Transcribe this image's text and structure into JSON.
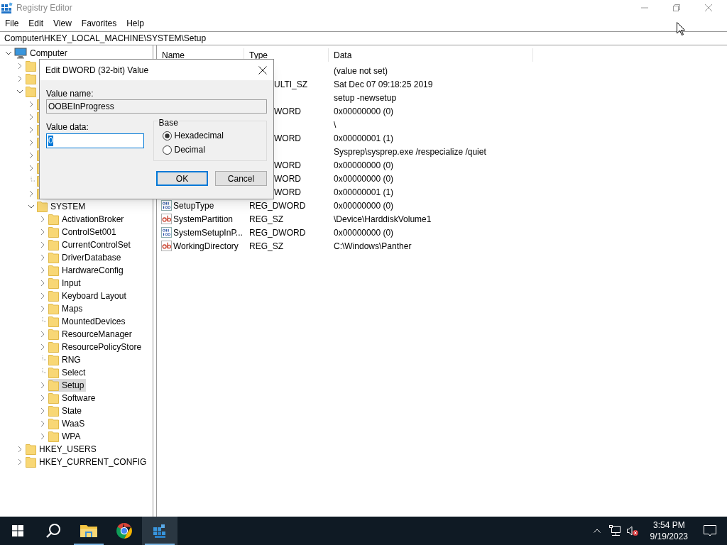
{
  "window": {
    "title": "Registry Editor"
  },
  "menu": [
    "File",
    "Edit",
    "View",
    "Favorites",
    "Help"
  ],
  "address": "Computer\\HKEY_LOCAL_MACHINE\\SYSTEM\\Setup",
  "tree": [
    {
      "label": "Computer",
      "kind": "computer",
      "expanded": true,
      "selected": false,
      "children": [
        {
          "kind": "folder",
          "expanded": false,
          "selected": false
        },
        {
          "kind": "folder",
          "expanded": false,
          "selected": false
        },
        {
          "kind": "folder",
          "expanded": true,
          "selected": false,
          "children": [
            {
              "kind": "folder",
              "expanded": false,
              "selected": false
            },
            {
              "kind": "folder",
              "expanded": false,
              "selected": false
            },
            {
              "kind": "folder",
              "expanded": false,
              "selected": false
            },
            {
              "kind": "folder",
              "expanded": false,
              "selected": false
            },
            {
              "kind": "folder",
              "expanded": false,
              "selected": false
            },
            {
              "kind": "folder",
              "expanded": false,
              "selected": false
            },
            {
              "kind": "leaf",
              "selected": false
            },
            {
              "kind": "folder",
              "expanded": false,
              "selected": false
            },
            {
              "label": "SYSTEM",
              "kind": "folder",
              "expanded": true,
              "selected": false,
              "children": [
                {
                  "label": "ActivationBroker",
                  "kind": "folder",
                  "expanded": false,
                  "selected": false
                },
                {
                  "label": "ControlSet001",
                  "kind": "folder",
                  "expanded": false,
                  "selected": false
                },
                {
                  "label": "CurrentControlSet",
                  "kind": "folder",
                  "expanded": false,
                  "selected": false
                },
                {
                  "label": "DriverDatabase",
                  "kind": "folder",
                  "expanded": false,
                  "selected": false
                },
                {
                  "label": "HardwareConfig",
                  "kind": "folder",
                  "expanded": false,
                  "selected": false
                },
                {
                  "label": "Input",
                  "kind": "folder",
                  "expanded": false,
                  "selected": false
                },
                {
                  "label": "Keyboard Layout",
                  "kind": "folder",
                  "expanded": false,
                  "selected": false
                },
                {
                  "label": "Maps",
                  "kind": "folder",
                  "expanded": false,
                  "selected": false
                },
                {
                  "label": "MountedDevices",
                  "kind": "leaf",
                  "selected": false
                },
                {
                  "label": "ResourceManager",
                  "kind": "folder",
                  "expanded": false,
                  "selected": false
                },
                {
                  "label": "ResourcePolicyStore",
                  "kind": "folder",
                  "expanded": false,
                  "selected": false
                },
                {
                  "label": "RNG",
                  "kind": "leaf",
                  "selected": false
                },
                {
                  "label": "Select",
                  "kind": "leaf",
                  "selected": false
                },
                {
                  "label": "Setup",
                  "kind": "folder",
                  "expanded": false,
                  "selected": true
                },
                {
                  "label": "Software",
                  "kind": "folder",
                  "expanded": false,
                  "selected": false
                },
                {
                  "label": "State",
                  "kind": "folder",
                  "expanded": false,
                  "selected": false
                },
                {
                  "label": "WaaS",
                  "kind": "folder",
                  "expanded": false,
                  "selected": false
                },
                {
                  "label": "WPA",
                  "kind": "folder",
                  "expanded": false,
                  "selected": false
                }
              ]
            }
          ]
        },
        {
          "label": "HKEY_USERS",
          "kind": "folder",
          "expanded": false,
          "selected": false
        },
        {
          "label": "HKEY_CURRENT_CONFIG",
          "kind": "folder",
          "expanded": false,
          "selected": false
        }
      ]
    }
  ],
  "table": {
    "columns": [
      "Name",
      "Type",
      "Data"
    ],
    "rows": [
      {
        "data": "(value not set)"
      },
      {
        "covered": true,
        "type": "ULTI_SZ",
        "data": "Sat Dec 07 09:18:25 2019"
      },
      {
        "data": "setup -newsetup"
      },
      {
        "covered": true,
        "type": "WORD",
        "data": "0x00000000 (0)"
      },
      {
        "data": "\\"
      },
      {
        "covered": true,
        "type": "WORD",
        "data": "0x00000001 (1)"
      },
      {
        "data": "Sysprep\\sysprep.exe /respecialize /quiet"
      },
      {
        "covered": true,
        "type": "WORD",
        "data": "0x00000000 (0)"
      },
      {
        "covered": true,
        "type": "WORD",
        "data": "0x00000000 (0)"
      },
      {
        "covered": true,
        "type": "WORD",
        "data": "0x00000001 (1)"
      },
      {
        "covered": false,
        "kind": "dword",
        "name": "SetupType",
        "type": "REG_DWORD",
        "data": "0x00000000 (0)"
      },
      {
        "covered": false,
        "kind": "string",
        "name": "SystemPartition",
        "type": "REG_SZ",
        "data": "\\Device\\HarddiskVolume1"
      },
      {
        "covered": false,
        "kind": "dword",
        "name": "SystemSetupInP...",
        "type": "REG_DWORD",
        "data": "0x00000000 (0)"
      },
      {
        "covered": false,
        "kind": "string",
        "name": "WorkingDirectory",
        "type": "REG_SZ",
        "data": "C:\\Windows\\Panther"
      }
    ]
  },
  "dialog": {
    "title": "Edit DWORD (32-bit) Value",
    "value_name_label": "Value name:",
    "value_name": "OOBEInProgress",
    "value_data_label": "Value data:",
    "value_data": "0",
    "base_label": "Base",
    "bases": [
      {
        "label": "Hexadecimal",
        "selected": true
      },
      {
        "label": "Decimal",
        "selected": false
      }
    ],
    "buttons": [
      {
        "label": "OK",
        "kind": "default"
      },
      {
        "label": "Cancel",
        "kind": "normal"
      }
    ]
  },
  "taskbar": {
    "apps": [
      {
        "kind": "start",
        "running": false,
        "selected": false
      },
      {
        "kind": "search",
        "running": false,
        "selected": false
      },
      {
        "kind": "explorer",
        "running": true,
        "selected": false
      },
      {
        "kind": "browser",
        "running": false,
        "selected": false
      },
      {
        "kind": "regedit",
        "running": true,
        "selected": true
      }
    ],
    "time": "3:54 PM",
    "date": "9/19/2023"
  }
}
